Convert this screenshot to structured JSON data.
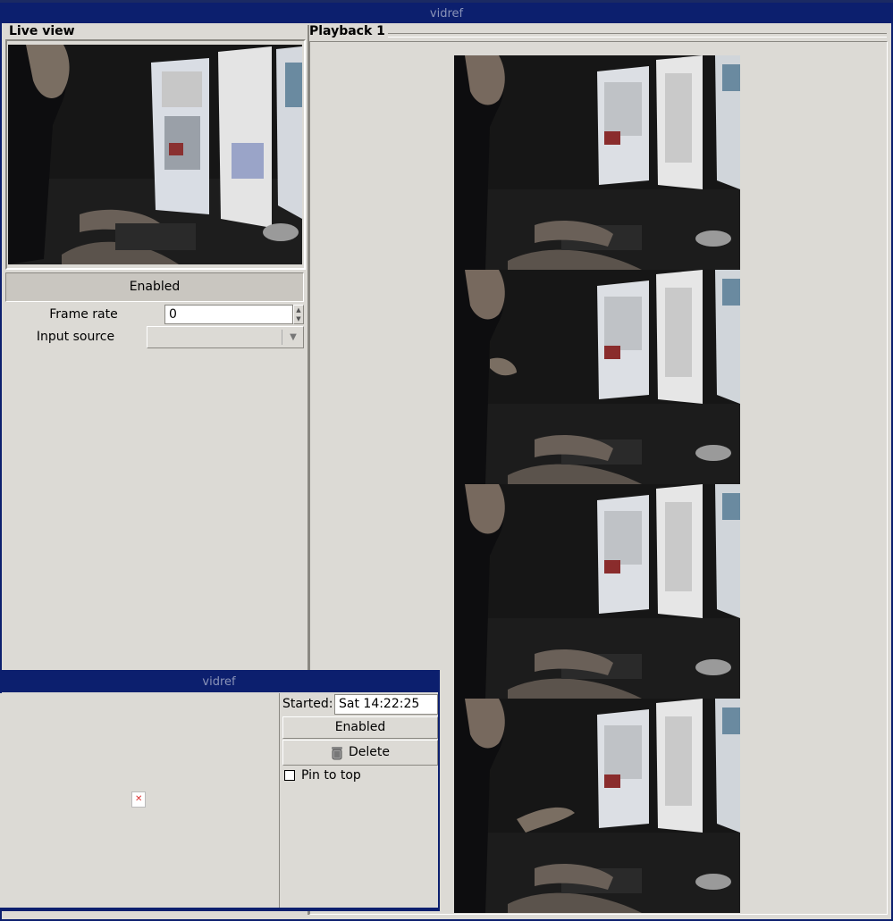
{
  "main_window": {
    "title": "vidref"
  },
  "live_panel": {
    "title": "Live view",
    "enabled_label": "Enabled",
    "frame_rate_label": "Frame rate",
    "frame_rate_value": "0",
    "input_source_label": "Input source",
    "input_source_value": ""
  },
  "playback_panel": {
    "title": "Playback 1"
  },
  "popup_window": {
    "title": "vidref",
    "started_label": "Started:",
    "started_value": "Sat 14:22:25",
    "enabled_label": "Enabled",
    "delete_label": "Delete",
    "pin_label": "Pin to top",
    "pin_checked": false
  },
  "icons": [
    "spin-up-icon",
    "spin-down-icon",
    "dropdown-arrow-icon",
    "trash-icon",
    "broken-image-icon"
  ]
}
